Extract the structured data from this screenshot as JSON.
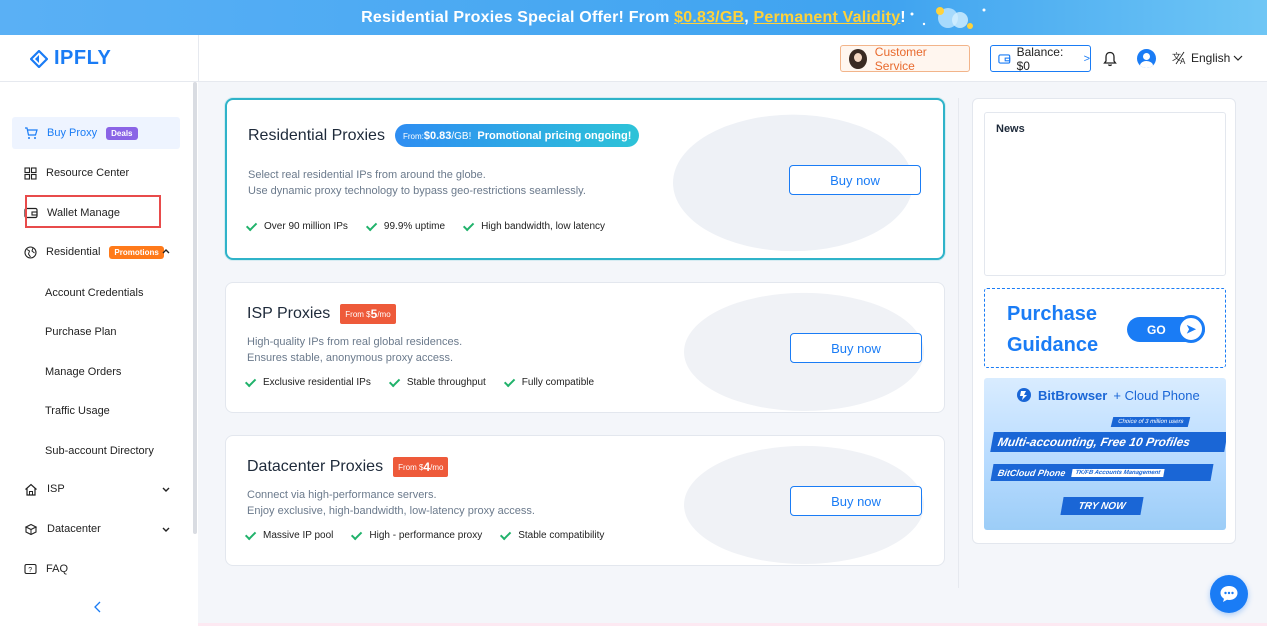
{
  "banner": {
    "prefix": "Residential Proxies Special Offer! From ",
    "price": "$0.83/GB",
    "mid": ", ",
    "validity": "Permanent Validity",
    "suffix": "!"
  },
  "logo": {
    "text": "IPFLY"
  },
  "header": {
    "customer_service": "Customer Service",
    "balance": "Balance: $0",
    "language": "English"
  },
  "sidebar": {
    "buy_proxy": "Buy Proxy",
    "deals_badge": "Deals",
    "resource_center": "Resource Center",
    "wallet_manage": "Wallet Manage",
    "residential": "Residential",
    "promotions_badge": "Promotions",
    "account_credentials": "Account Credentials",
    "purchase_plan": "Purchase Plan",
    "manage_orders": "Manage Orders",
    "traffic_usage": "Traffic Usage",
    "sub_account_directory": "Sub-account Directory",
    "isp": "ISP",
    "datacenter": "Datacenter",
    "faq": "FAQ"
  },
  "cards": {
    "residential": {
      "title": "Residential Proxies",
      "pill_from": "From:",
      "pill_price": "$0.83",
      "pill_unit": "/GB!",
      "pill_note": "Promotional pricing ongoing!",
      "desc1": "Select real residential IPs from around the globe.",
      "desc2": "Use dynamic proxy technology to bypass geo-restrictions seamlessly.",
      "feat1": "Over 90 million IPs",
      "feat2": "99.9% uptime",
      "feat3": "High bandwidth, low latency",
      "buy": "Buy now"
    },
    "isp": {
      "title": "ISP Proxies",
      "tag_from": "From $",
      "tag_price": "5",
      "tag_unit": "/mo",
      "desc1": "High-quality IPs from real global residences.",
      "desc2": "Ensures stable, anonymous proxy access.",
      "feat1": "Exclusive residential IPs",
      "feat2": "Stable throughput",
      "feat3": "Fully compatible",
      "buy": "Buy now"
    },
    "datacenter": {
      "title": "Datacenter Proxies",
      "tag_from": "From $",
      "tag_price": "4",
      "tag_unit": "/mo",
      "desc1": "Connect via high-performance servers.",
      "desc2": "Enjoy exclusive, high-bandwidth, low-latency proxy access.",
      "feat1": "Massive IP pool",
      "feat2": "High - performance proxy",
      "feat3": "Stable compatibility",
      "buy": "Buy now"
    }
  },
  "right": {
    "news_title": "News",
    "guide_line1": "Purchase",
    "guide_line2": "Guidance",
    "go": "GO",
    "ad": {
      "brand": "BitBrowser",
      "plus": "+ Cloud Phone",
      "small": "Choice of 3 million users",
      "band": "Multi-accounting, Free 10 Profiles",
      "band2_a": "BitCloud Phone",
      "band2_b": "TK/FB Accounts Management",
      "try": "TRY NOW"
    }
  },
  "colors": {
    "accent": "#1a7cf5",
    "promo": "#ff7a1a",
    "tag": "#ee5a3a",
    "check": "#20b26b"
  }
}
